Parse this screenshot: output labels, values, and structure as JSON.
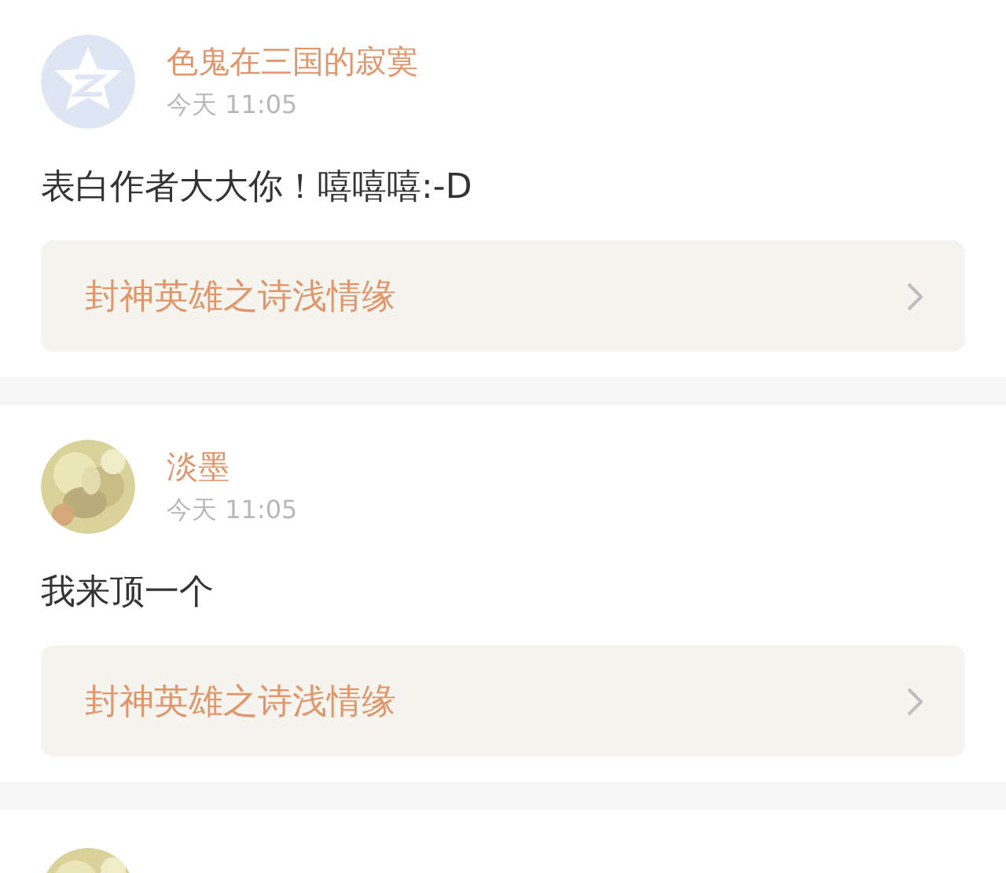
{
  "posts": [
    {
      "avatar": {
        "kind": "icon"
      },
      "name": "色鬼在三国的寂寞",
      "time": "今天 11:05",
      "content": "表白作者大大你！嘻嘻嘻:-D",
      "link": "封神英雄之诗浅情缘"
    },
    {
      "name": "淡墨",
      "time": "今天 11:05",
      "content": "我来顶一个",
      "link": "封神英雄之诗浅情缘"
    }
  ]
}
